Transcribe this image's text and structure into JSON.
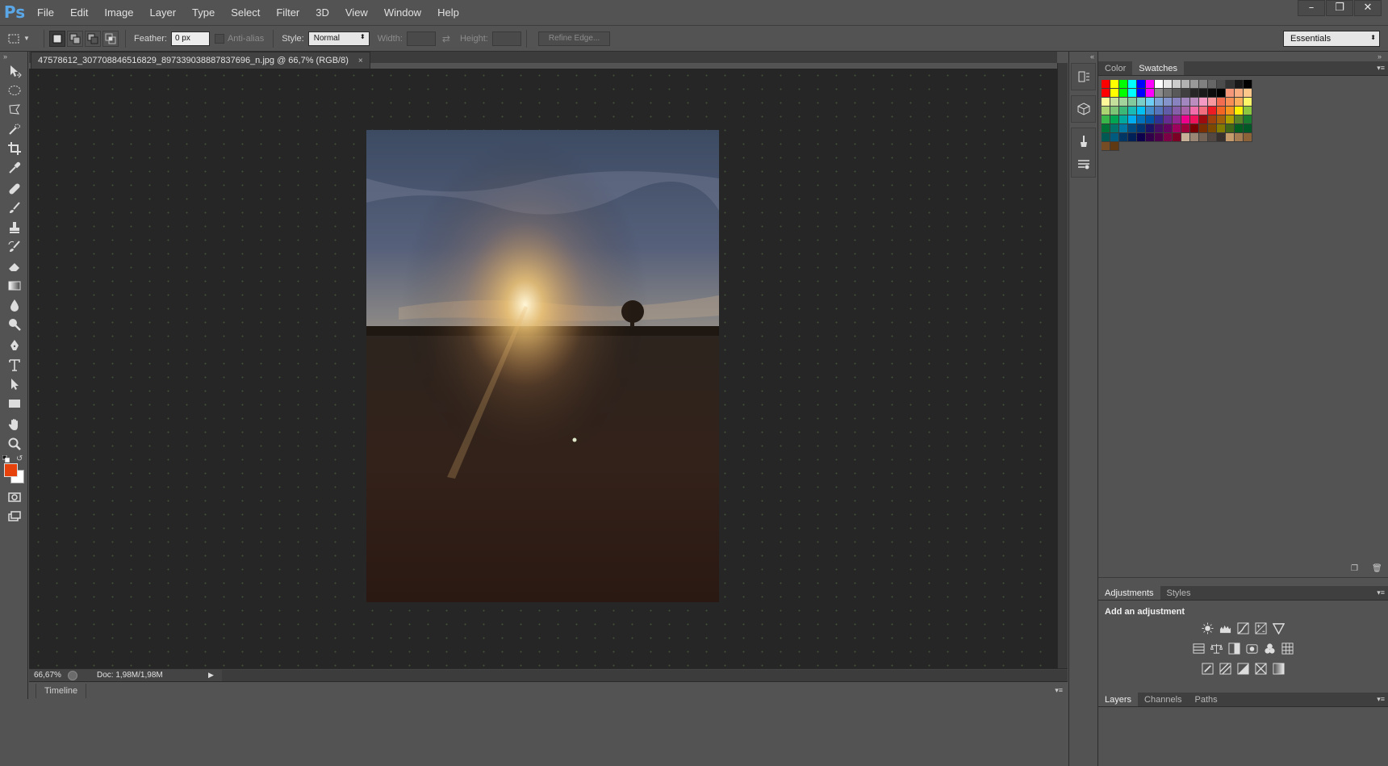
{
  "app": {
    "logo": "Ps"
  },
  "menu": [
    "File",
    "Edit",
    "Image",
    "Layer",
    "Type",
    "Select",
    "Filter",
    "3D",
    "View",
    "Window",
    "Help"
  ],
  "window_controls": {
    "minimize": "–",
    "maximize": "❐",
    "close": "✕"
  },
  "options_bar": {
    "feather_label": "Feather:",
    "feather_value": "0 px",
    "anti_alias_label": "Anti-alias",
    "style_label": "Style:",
    "style_value": "Normal",
    "width_label": "Width:",
    "height_label": "Height:",
    "refine_edge_label": "Refine Edge...",
    "workspace_value": "Essentials"
  },
  "document": {
    "tab_title": "47578612_307708846516829_897339038887837696_n.jpg @ 66,7% (RGB/8)",
    "close": "×"
  },
  "status": {
    "zoom": "66,67%",
    "doc_info": "Doc: 1,98M/1,98M"
  },
  "timeline": {
    "label": "Timeline"
  },
  "colors": {
    "foreground": "#e8420c",
    "background": "#ffffff"
  },
  "panels": {
    "color_tab": "Color",
    "swatches_tab": "Swatches",
    "adjustments_tab": "Adjustments",
    "styles_tab": "Styles",
    "adjustment_title": "Add an adjustment",
    "layers_tab": "Layers",
    "channels_tab": "Channels",
    "paths_tab": "Paths"
  },
  "swatches": [
    "#ff0000",
    "#ffff00",
    "#00ff00",
    "#00ffff",
    "#0000ff",
    "#ff00ff",
    "#ffffff",
    "#e5e5e5",
    "#cccccc",
    "#b2b2b2",
    "#999999",
    "#808080",
    "#666666",
    "#4c4c4c",
    "#333333",
    "#191919",
    "#000000",
    "#ff0000",
    "#ffff00",
    "#00ff00",
    "#00ffff",
    "#0000ff",
    "#ff00ff",
    "#8c8c8c",
    "#737373",
    "#595959",
    "#404040",
    "#262626",
    "#1a1a1a",
    "#0d0d0d",
    "#000000",
    "#f7977a",
    "#f9ad81",
    "#fdc68a",
    "#fff79a",
    "#c4df9b",
    "#a3d39c",
    "#82ca9d",
    "#7bcdc8",
    "#6ecff6",
    "#7ea7d8",
    "#8493ca",
    "#8882be",
    "#a187be",
    "#bc8dbf",
    "#f49ac2",
    "#f6989d",
    "#f26c4f",
    "#f68e55",
    "#fbaf5d",
    "#fff568",
    "#acd372",
    "#7cc576",
    "#3bb878",
    "#1abbb4",
    "#00bff3",
    "#438ccb",
    "#5574b9",
    "#605ca8",
    "#855fa8",
    "#a763a8",
    "#f06ea9",
    "#f26d7d",
    "#ed1c24",
    "#f26522",
    "#f7941d",
    "#fff200",
    "#8dc73f",
    "#39b54a",
    "#00a651",
    "#00a99d",
    "#00aeef",
    "#0072bc",
    "#0054a6",
    "#2e3192",
    "#662d91",
    "#92278f",
    "#ec008c",
    "#ed145b",
    "#9e0b0f",
    "#a0410d",
    "#a36209",
    "#aba000",
    "#598527",
    "#1a7b30",
    "#007236",
    "#00746b",
    "#0076a3",
    "#004b80",
    "#003471",
    "#1b1464",
    "#440e62",
    "#630460",
    "#9e005d",
    "#9e0039",
    "#790000",
    "#7b2e00",
    "#7d4900",
    "#827b00",
    "#406618",
    "#005e20",
    "#005826",
    "#005952",
    "#005b7f",
    "#003663",
    "#002157",
    "#0d004c",
    "#32004b",
    "#4b0049",
    "#7b0046",
    "#7a0026",
    "#c7b299",
    "#998675",
    "#736357",
    "#534741",
    "#37302d",
    "#c69c6d",
    "#a67c52",
    "#8c6239",
    "#754c24",
    "#603913"
  ]
}
